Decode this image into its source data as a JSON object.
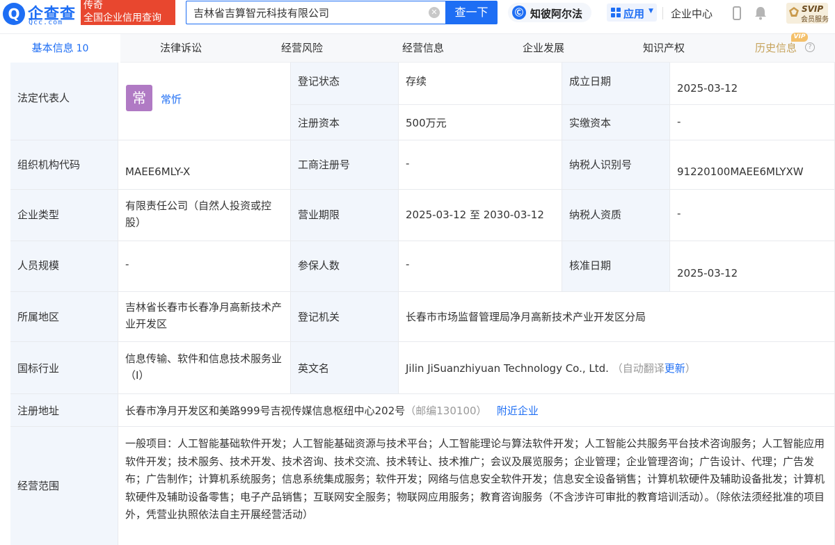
{
  "header": {
    "logo_mark": "Q",
    "logo_name": "企查查",
    "logo_domain": "Qcc.com",
    "slogan_line1": "传奇",
    "slogan_line2": "全国企业信用查询",
    "search_value": "吉林省吉算智元科技有限公司",
    "search_button": "查一下",
    "zhibi_label": "知彼阿尔法",
    "apps_label": "应用",
    "enterprise_center": "企业中心",
    "svip_title": "SVIP",
    "svip_sub": "会员服务",
    "icons": [
      "clear-icon",
      "zhibi-icon",
      "apps-grid-icon",
      "phone-icon",
      "bell-icon",
      "svip-badge-icon"
    ]
  },
  "tabs": {
    "basic": "基本信息",
    "basic_count": "10",
    "legal": "法律诉讼",
    "risk": "经营风险",
    "operation": "经营信息",
    "development": "企业发展",
    "ip": "知识产权",
    "history": "历史信息",
    "vip_tag": "VIP"
  },
  "info": {
    "legal_rep": {
      "label": "法定代表人",
      "avatar": "常",
      "name": "常忻"
    },
    "reg_status": {
      "label": "登记状态",
      "value": "存续"
    },
    "est_date": {
      "label": "成立日期",
      "value": "2025-03-12"
    },
    "reg_capital": {
      "label": "注册资本",
      "value": "500万元"
    },
    "paid_capital": {
      "label": "实缴资本",
      "value": "-"
    },
    "org_code": {
      "label": "组织机构代码",
      "value": "MAEE6MLY-X"
    },
    "biz_reg_no": {
      "label": "工商注册号",
      "value": "-"
    },
    "taxpayer_id": {
      "label": "纳税人识别号",
      "value": "91220100MAEE6MLYXW"
    },
    "company_type": {
      "label": "企业类型",
      "value": "有限责任公司（自然人投资或控股）"
    },
    "biz_term": {
      "label": "营业期限",
      "value": "2025-03-12 至 2030-03-12"
    },
    "taxpayer_qual": {
      "label": "纳税人资质",
      "value": "-"
    },
    "staff_size": {
      "label": "人员规模",
      "value": "-"
    },
    "insured": {
      "label": "参保人数",
      "value": "-"
    },
    "approval_date": {
      "label": "核准日期",
      "value": "2025-03-12"
    },
    "region": {
      "label": "所属地区",
      "value": "吉林省长春市长春净月高新技术产业开发区"
    },
    "reg_authority": {
      "label": "登记机关",
      "value": "长春市市场监督管理局净月高新技术产业开发区分局"
    },
    "industry": {
      "label": "国标行业",
      "value": "信息传输、软件和信息技术服务业（I）"
    },
    "english_name": {
      "label": "英文名",
      "value": "Jilin JiSuanzhiyuan Technology Co., Ltd.",
      "note_prefix": "（自动翻译",
      "update_link": "更新",
      "note_suffix": "）"
    },
    "reg_address": {
      "label": "注册地址",
      "value": "长春市净月开发区和美路999号吉视传媒信息枢纽中心202号",
      "postcode": "（邮编130100）",
      "nearby_link": "附近企业"
    },
    "biz_scope": {
      "label": "经营范围",
      "value": "一般项目：人工智能基础软件开发；人工智能基础资源与技术平台；人工智能理论与算法软件开发；人工智能公共服务平台技术咨询服务；人工智能应用软件开发；技术服务、技术开发、技术咨询、技术交流、技术转让、技术推广；会议及展览服务；企业管理；企业管理咨询；广告设计、代理；广告发布；广告制作；计算机系统服务；信息系统集成服务；软件开发；网络与信息安全软件开发；信息安全设备销售；计算机软硬件及辅助设备批发；计算机软硬件及辅助设备零售；电子产品销售；互联网安全服务；物联网应用服务；教育咨询服务（不含涉许可审批的教育培训活动）。（除依法须经批准的项目外，凭营业执照依法自主开展经营活动）"
    }
  }
}
